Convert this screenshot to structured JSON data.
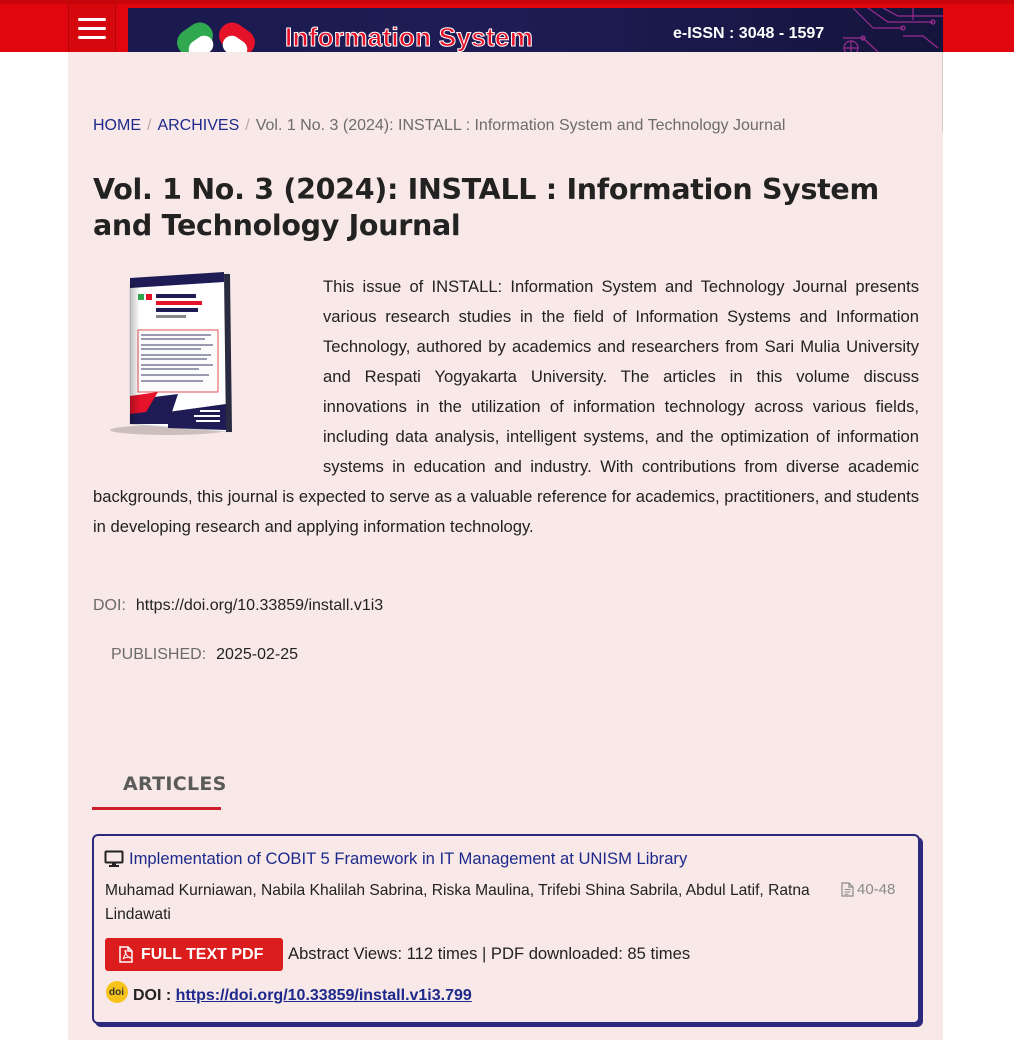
{
  "header": {
    "banner_title": "Information System",
    "issn": "e-ISSN : 3048 - 1597"
  },
  "breadcrumb": {
    "home": "HOME",
    "archives": "ARCHIVES",
    "separator": "/",
    "current": "Vol. 1 No. 3 (2024): INSTALL : Information System and Technology Journal"
  },
  "issue": {
    "title": "Vol. 1 No. 3 (2024): INSTALL : Information System and Technology Journal",
    "description": "This issue of INSTALL: Information System and Technology Journal presents various research studies in the field of Information Systems and Information Technology, authored by academics and researchers from Sari Mulia University and Respati Yogyakarta University. The articles in this volume discuss innovations in the utilization of information technology across various fields, including data analysis, intelligent systems, and the optimization of information systems in education and industry. With contributions from diverse academic backgrounds, this journal is expected to serve as a valuable reference for academics, practitioners, and students in developing research and applying information technology.",
    "doi_label": "DOI:",
    "doi_value": "https://doi.org/10.33859/install.v1i3",
    "published_label": "PUBLISHED:",
    "published_value": "2025-02-25"
  },
  "tabs": {
    "articles": "ARTICLES"
  },
  "articles": [
    {
      "title": "Implementation of COBIT 5 Framework in IT Management at UNISM Library",
      "authors": "Muhamad Kurniawan, Nabila Khalilah Sabrina, Riska Maulina, Trifebi Shina Sabrila, Abdul Latif, Ratna Lindawati",
      "pages": "40-48",
      "pdf_label": "FULL TEXT PDF",
      "stats": "Abstract Views: 112 times | PDF downloaded: 85 times",
      "doi_label": "DOI :",
      "doi_url": "https://doi.org/10.33859/install.v1i3.799"
    }
  ],
  "colors": {
    "header_red": "#e0060d",
    "panel_bg": "#f8e8e7",
    "link_blue": "#1d2a8c",
    "accent_red": "#cc1f2a",
    "card_border": "#2c2a7d"
  },
  "icons": {
    "menu": "hamburger-icon",
    "article": "monitor-icon",
    "pages": "file-text-icon",
    "pdf": "pdf-file-icon",
    "doi": "doi-badge-icon"
  }
}
